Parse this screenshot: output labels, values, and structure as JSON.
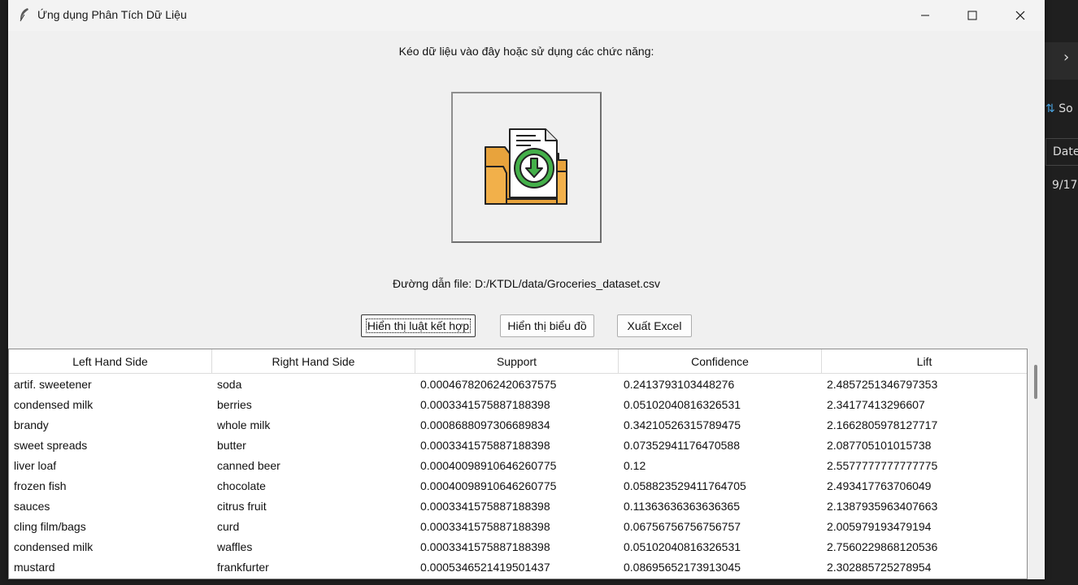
{
  "window": {
    "title": "Ứng dụng Phân Tích Dữ Liệu"
  },
  "main": {
    "prompt": "Kéo dữ liệu vào đây hoặc sử dụng các chức năng:",
    "file_path": "Đường dẫn file: D:/KTDL/data/Groceries_dataset.csv",
    "dropzone_icon": "folder-download-icon"
  },
  "buttons": {
    "rules": "Hiển thị luật kết hợp",
    "chart": "Hiển thị biểu đồ",
    "export": "Xuất Excel"
  },
  "table": {
    "columns": [
      "Left Hand Side",
      "Right Hand Side",
      "Support",
      "Confidence",
      "Lift"
    ],
    "rows": [
      [
        "artif. sweetener",
        "soda",
        "0.00046782062420637575",
        "0.2413793103448276",
        "2.4857251346797353"
      ],
      [
        "condensed milk",
        "berries",
        "0.0003341575887188398",
        "0.05102040816326531",
        "2.34177413296607"
      ],
      [
        "brandy",
        "whole milk",
        "0.0008688097306689834",
        "0.34210526315789475",
        "2.1662805978127717"
      ],
      [
        "sweet spreads",
        "butter",
        "0.0003341575887188398",
        "0.07352941176470588",
        "2.087705101015738"
      ],
      [
        "liver loaf",
        "canned beer",
        "0.00040098910646260775",
        "0.12",
        "2.5577777777777775"
      ],
      [
        "frozen fish",
        "chocolate",
        "0.00040098910646260775",
        "0.058823529411764705",
        "2.493417763706049"
      ],
      [
        "sauces",
        "citrus fruit",
        "0.0003341575887188398",
        "0.11363636363636365",
        "2.1387935963407663"
      ],
      [
        "cling film/bags",
        "curd",
        "0.0003341575887188398",
        "0.06756756756756757",
        "2.005979193479194"
      ],
      [
        "condensed milk",
        "waffles",
        "0.0003341575887188398",
        "0.05102040816326531",
        "2.7560229868120536"
      ],
      [
        "mustard",
        "frankfurter",
        "0.0005346521419501437",
        "0.08695652173913045",
        "2.302885725278954"
      ]
    ]
  },
  "background": {
    "right_sort_label": "So",
    "right_date_header": "Date",
    "right_date_value": "9/17,"
  }
}
